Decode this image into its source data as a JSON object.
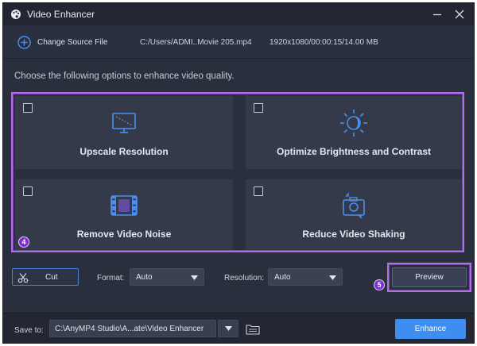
{
  "window": {
    "title": "Video Enhancer"
  },
  "source": {
    "change_label": "Change Source File",
    "path": "C:/Users/ADMI..Movie 205.mp4",
    "meta": "1920x1080/00:00:15/14.00 MB"
  },
  "instruction": "Choose the following options to enhance video quality.",
  "options": [
    {
      "label": "Upscale Resolution",
      "icon": "monitor-icon",
      "checked": false
    },
    {
      "label": "Optimize Brightness and Contrast",
      "icon": "brightness-icon",
      "checked": false
    },
    {
      "label": "Remove Video Noise",
      "icon": "film-icon",
      "checked": false
    },
    {
      "label": "Reduce Video Shaking",
      "icon": "stabilize-camera-icon",
      "checked": false
    }
  ],
  "steps": {
    "options_badge": "4",
    "preview_badge": "5"
  },
  "controls": {
    "cut_label": "Cut",
    "format_label": "Format:",
    "format_value": "Auto",
    "resolution_label": "Resolution:",
    "resolution_value": "Auto",
    "preview_label": "Preview"
  },
  "bottom": {
    "save_label": "Save to:",
    "save_path": "C:\\AnyMP4 Studio\\A...ate\\Video Enhancer",
    "enhance_label": "Enhance"
  },
  "colors": {
    "accent": "#4a8ff0",
    "highlight": "#b26ee8",
    "background": "#2a2f3d",
    "card": "#353a4b"
  }
}
